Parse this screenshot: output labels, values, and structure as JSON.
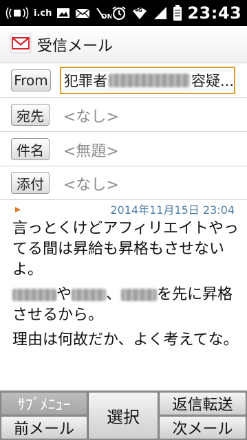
{
  "status_bar": {
    "carrier_icon_label": "i.ch",
    "network": "4G",
    "time": "23:43"
  },
  "title_bar": {
    "title": "受信メール"
  },
  "headers": {
    "from_label": "From",
    "from_value_start": "犯罪者",
    "from_value_end": "容疑...",
    "to_label": "宛先",
    "to_value": "<なし>",
    "subject_label": "件名",
    "subject_value": "<無題>",
    "attachment_label": "添付",
    "attachment_value": "<なし>"
  },
  "message": {
    "date": "2014年11月15日 23:04",
    "line1": "言っとくけどアフィリエイトやってる間は昇給も昇格もさせないよ。",
    "line2_a": "や",
    "line2_b": "、",
    "line2_c": "を先に昇格させるから。",
    "line3": "理由は何故だか、よく考えてな。"
  },
  "softkeys": {
    "submenu": "ｻﾌﾞﾒﾆｭｰ",
    "prev_mail": "前メール",
    "select": "選択",
    "reply_forward": "返信転送",
    "next_mail": "次メール"
  },
  "colors": {
    "from_focus_border": "#d79b28",
    "date_text": "#4d7da7",
    "arrow_mark": "#e07820"
  }
}
